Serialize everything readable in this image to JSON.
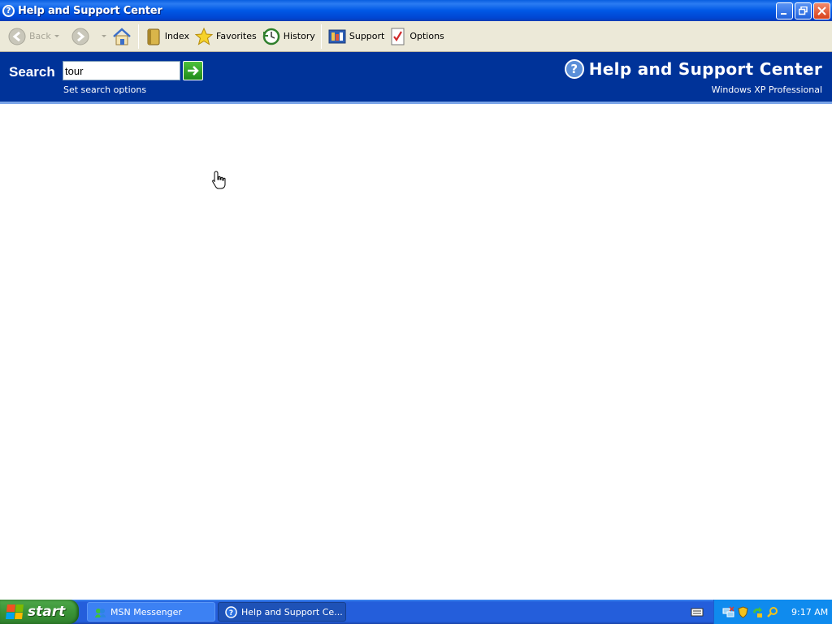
{
  "window": {
    "title": "Help and Support Center",
    "title_icon": "help-icon"
  },
  "toolbar": {
    "back_label": "Back",
    "index_label": "Index",
    "favorites_label": "Favorites",
    "history_label": "History",
    "support_label": "Support",
    "options_label": "Options"
  },
  "header": {
    "search_label": "Search",
    "search_value": "tour",
    "search_options": "Set search options",
    "brand_title": "Help and Support Center",
    "brand_subtitle": "Windows XP Professional",
    "brand_icon": "question-mark-icon"
  },
  "taskbar": {
    "start_label": "start",
    "tasks": [
      {
        "label": "MSN Messenger",
        "icon": "msn-icon"
      },
      {
        "label": "Help and Support Ce...",
        "icon": "help-icon"
      }
    ],
    "clock": "9:17 AM",
    "tray_icons": [
      "network-icon",
      "shield-icon",
      "update-icon",
      "search-icon"
    ]
  },
  "colors": {
    "header_blue": "#003399",
    "title_blue": "#0058e6",
    "toolbar_bg": "#ece9d8",
    "taskbar_blue": "#245edb",
    "start_green": "#3a9437",
    "tray_blue": "#0f8bee"
  }
}
